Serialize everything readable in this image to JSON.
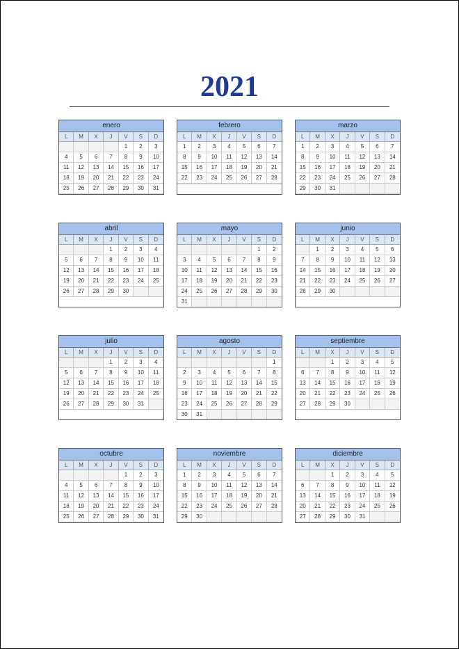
{
  "year": "2021",
  "dow": [
    "L",
    "M",
    "X",
    "J",
    "V",
    "S",
    "D"
  ],
  "months": [
    {
      "name": "enero",
      "weeks": [
        [
          "",
          "",
          "",
          "",
          "1",
          "2",
          "3"
        ],
        [
          "4",
          "5",
          "6",
          "7",
          "8",
          "9",
          "10"
        ],
        [
          "11",
          "12",
          "13",
          "14",
          "15",
          "16",
          "17"
        ],
        [
          "18",
          "19",
          "20",
          "21",
          "22",
          "23",
          "24"
        ],
        [
          "25",
          "26",
          "27",
          "28",
          "29",
          "30",
          "31"
        ],
        [
          "",
          "",
          "",
          "",
          "",
          "",
          ""
        ]
      ]
    },
    {
      "name": "febrero",
      "weeks": [
        [
          "1",
          "2",
          "3",
          "4",
          "5",
          "6",
          "7"
        ],
        [
          "8",
          "9",
          "10",
          "11",
          "12",
          "13",
          "14"
        ],
        [
          "15",
          "16",
          "17",
          "18",
          "19",
          "20",
          "21"
        ],
        [
          "22",
          "23",
          "24",
          "25",
          "26",
          "27",
          "28"
        ],
        [
          "",
          "",
          "",
          "",
          "",
          "",
          ""
        ],
        [
          "",
          "",
          "",
          "",
          "",
          "",
          ""
        ]
      ]
    },
    {
      "name": "marzo",
      "weeks": [
        [
          "1",
          "2",
          "3",
          "4",
          "5",
          "6",
          "7"
        ],
        [
          "8",
          "9",
          "10",
          "11",
          "12",
          "13",
          "14"
        ],
        [
          "15",
          "16",
          "17",
          "18",
          "19",
          "20",
          "21"
        ],
        [
          "22",
          "23",
          "24",
          "25",
          "26",
          "27",
          "28"
        ],
        [
          "29",
          "30",
          "31",
          "",
          "",
          "",
          ""
        ],
        [
          "",
          "",
          "",
          "",
          "",
          "",
          ""
        ]
      ]
    },
    {
      "name": "abril",
      "weeks": [
        [
          "",
          "",
          "",
          "1",
          "2",
          "3",
          "4"
        ],
        [
          "5",
          "6",
          "7",
          "8",
          "9",
          "10",
          "11"
        ],
        [
          "12",
          "13",
          "14",
          "15",
          "16",
          "17",
          "18"
        ],
        [
          "19",
          "20",
          "21",
          "22",
          "23",
          "24",
          "25"
        ],
        [
          "26",
          "27",
          "28",
          "29",
          "30",
          "",
          ""
        ],
        [
          "",
          "",
          "",
          "",
          "",
          "",
          ""
        ]
      ]
    },
    {
      "name": "mayo",
      "weeks": [
        [
          "",
          "",
          "",
          "",
          "",
          "1",
          "2"
        ],
        [
          "3",
          "4",
          "5",
          "6",
          "7",
          "8",
          "9"
        ],
        [
          "10",
          "11",
          "12",
          "13",
          "14",
          "15",
          "16"
        ],
        [
          "17",
          "18",
          "19",
          "20",
          "21",
          "22",
          "23"
        ],
        [
          "24",
          "25",
          "26",
          "27",
          "28",
          "29",
          "30"
        ],
        [
          "31",
          "",
          "",
          "",
          "",
          "",
          ""
        ]
      ]
    },
    {
      "name": "junio",
      "weeks": [
        [
          "",
          "1",
          "2",
          "3",
          "4",
          "5",
          "6"
        ],
        [
          "7",
          "8",
          "9",
          "10",
          "11",
          "12",
          "13"
        ],
        [
          "14",
          "15",
          "16",
          "17",
          "18",
          "19",
          "20"
        ],
        [
          "21",
          "22",
          "23",
          "24",
          "25",
          "26",
          "27"
        ],
        [
          "28",
          "29",
          "30",
          "",
          "",
          "",
          ""
        ],
        [
          "",
          "",
          "",
          "",
          "",
          "",
          ""
        ]
      ]
    },
    {
      "name": "julio",
      "weeks": [
        [
          "",
          "",
          "",
          "1",
          "2",
          "3",
          "4"
        ],
        [
          "5",
          "6",
          "7",
          "8",
          "9",
          "10",
          "11"
        ],
        [
          "12",
          "13",
          "14",
          "15",
          "16",
          "17",
          "18"
        ],
        [
          "19",
          "20",
          "21",
          "22",
          "23",
          "24",
          "25"
        ],
        [
          "26",
          "27",
          "28",
          "29",
          "30",
          "31",
          ""
        ],
        [
          "",
          "",
          "",
          "",
          "",
          "",
          ""
        ]
      ]
    },
    {
      "name": "agosto",
      "weeks": [
        [
          "",
          "",
          "",
          "",
          "",
          "",
          "1"
        ],
        [
          "2",
          "3",
          "4",
          "5",
          "6",
          "7",
          "8"
        ],
        [
          "9",
          "10",
          "11",
          "12",
          "13",
          "14",
          "15"
        ],
        [
          "16",
          "17",
          "18",
          "19",
          "20",
          "21",
          "22"
        ],
        [
          "23",
          "24",
          "25",
          "26",
          "27",
          "28",
          "29"
        ],
        [
          "30",
          "31",
          "",
          "",
          "",
          "",
          ""
        ]
      ]
    },
    {
      "name": "septiembre",
      "weeks": [
        [
          "",
          "",
          "1",
          "2",
          "3",
          "4",
          "5"
        ],
        [
          "6",
          "7",
          "8",
          "9",
          "10",
          "11",
          "12"
        ],
        [
          "13",
          "14",
          "15",
          "16",
          "17",
          "18",
          "19"
        ],
        [
          "20",
          "21",
          "22",
          "23",
          "24",
          "25",
          "26"
        ],
        [
          "27",
          "28",
          "29",
          "30",
          "",
          "",
          ""
        ],
        [
          "",
          "",
          "",
          "",
          "",
          "",
          ""
        ]
      ]
    },
    {
      "name": "octubre",
      "weeks": [
        [
          "",
          "",
          "",
          "",
          "1",
          "2",
          "3"
        ],
        [
          "4",
          "5",
          "6",
          "7",
          "8",
          "9",
          "10"
        ],
        [
          "11",
          "12",
          "13",
          "14",
          "15",
          "16",
          "17"
        ],
        [
          "18",
          "19",
          "20",
          "21",
          "22",
          "23",
          "24"
        ],
        [
          "25",
          "26",
          "27",
          "28",
          "29",
          "30",
          "31"
        ],
        [
          "",
          "",
          "",
          "",
          "",
          "",
          ""
        ]
      ]
    },
    {
      "name": "noviembre",
      "weeks": [
        [
          "1",
          "2",
          "3",
          "4",
          "5",
          "6",
          "7"
        ],
        [
          "8",
          "9",
          "10",
          "11",
          "12",
          "13",
          "14"
        ],
        [
          "15",
          "16",
          "17",
          "18",
          "19",
          "20",
          "21"
        ],
        [
          "22",
          "23",
          "24",
          "25",
          "26",
          "27",
          "28"
        ],
        [
          "29",
          "30",
          "",
          "",
          "",
          "",
          ""
        ],
        [
          "",
          "",
          "",
          "",
          "",
          "",
          ""
        ]
      ]
    },
    {
      "name": "diciembre",
      "weeks": [
        [
          "",
          "",
          "1",
          "2",
          "3",
          "4",
          "5"
        ],
        [
          "6",
          "7",
          "8",
          "9",
          "10",
          "11",
          "12"
        ],
        [
          "13",
          "14",
          "15",
          "16",
          "17",
          "18",
          "19"
        ],
        [
          "20",
          "21",
          "22",
          "23",
          "24",
          "25",
          "26"
        ],
        [
          "27",
          "28",
          "29",
          "30",
          "31",
          "",
          ""
        ],
        [
          "",
          "",
          "",
          "",
          "",
          "",
          ""
        ]
      ]
    }
  ]
}
